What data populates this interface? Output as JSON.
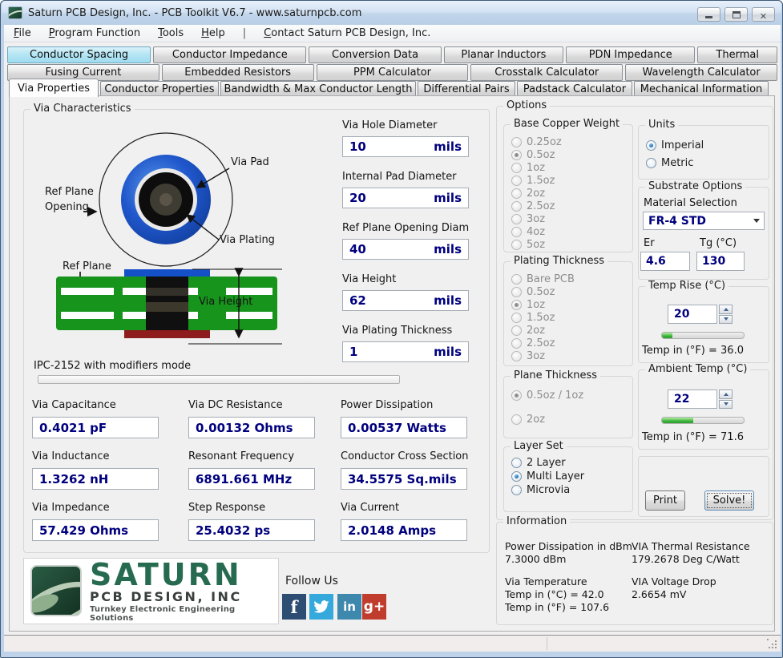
{
  "titlebar": {
    "title": "Saturn PCB Design, Inc. - PCB Toolkit V6.7 - www.saturnpcb.com"
  },
  "menubar": {
    "items": [
      "File",
      "Program Function",
      "Tools",
      "Help"
    ],
    "separator": "|",
    "contact": "Contact Saturn PCB Design, Inc."
  },
  "tabs": {
    "row1": [
      "Conductor Spacing",
      "Conductor Impedance",
      "Conversion Data",
      "Planar Inductors",
      "PDN Impedance",
      "Thermal"
    ],
    "row2": [
      "Fusing Current",
      "Embedded Resistors",
      "PPM Calculator",
      "Crosstalk Calculator",
      "Wavelength Calculator"
    ],
    "row3": [
      "Via Properties",
      "Conductor Properties",
      "Bandwidth & Max Conductor Length",
      "Differential Pairs",
      "Padstack Calculator",
      "Mechanical Information"
    ],
    "active_row1": "Conductor Spacing",
    "active_row3": "Via Properties"
  },
  "via": {
    "title": "Via Characteristics",
    "diagram": {
      "via_pad": "Via Pad",
      "ref_plane": "Ref Plane",
      "opening": "Opening",
      "via_plating": "Via Plating",
      "ref_plane2": "Ref Plane",
      "via_height": "Via Height"
    },
    "mode_note": "IPC-2152 with modifiers mode",
    "inputs": [
      {
        "label": "Via Hole Diameter",
        "value": "10",
        "unit": "mils"
      },
      {
        "label": "Internal Pad Diameter",
        "value": "20",
        "unit": "mils"
      },
      {
        "label": "Ref Plane Opening Diam",
        "value": "40",
        "unit": "mils"
      },
      {
        "label": "Via Height",
        "value": "62",
        "unit": "mils"
      },
      {
        "label": "Via Plating Thickness",
        "value": "1",
        "unit": "mils"
      }
    ],
    "results": [
      {
        "label": "Via Capacitance",
        "value": "0.4021 pF"
      },
      {
        "label": "Via DC Resistance",
        "value": "0.00132 Ohms"
      },
      {
        "label": "Power Dissipation",
        "value": "0.00537 Watts"
      },
      {
        "label": "Via Inductance",
        "value": "1.3262 nH"
      },
      {
        "label": "Resonant Frequency",
        "value": "6891.661 MHz"
      },
      {
        "label": "Conductor Cross Section",
        "value": "34.5575 Sq.mils"
      },
      {
        "label": "Via Impedance",
        "value": "57.429 Ohms"
      },
      {
        "label": "Step Response",
        "value": "25.4032 ps"
      },
      {
        "label": "Via Current",
        "value": "2.0148 Amps"
      }
    ]
  },
  "options": {
    "title": "Options",
    "base_copper_weight": {
      "title": "Base Copper Weight",
      "options": [
        "0.25oz",
        "0.5oz",
        "1oz",
        "1.5oz",
        "2oz",
        "2.5oz",
        "3oz",
        "4oz",
        "5oz"
      ],
      "selected": "0.5oz"
    },
    "plating_thickness": {
      "title": "Plating Thickness",
      "options": [
        "Bare PCB",
        "0.5oz",
        "1oz",
        "1.5oz",
        "2oz",
        "2.5oz",
        "3oz"
      ],
      "selected": "1oz"
    },
    "plane_thickness": {
      "title": "Plane Thickness",
      "options": [
        "0.5oz / 1oz",
        "2oz"
      ],
      "selected": "0.5oz / 1oz"
    },
    "layer_set": {
      "title": "Layer Set",
      "options": [
        "2 Layer",
        "Multi Layer",
        "Microvia"
      ],
      "selected": "Multi Layer"
    },
    "units": {
      "title": "Units",
      "options": [
        "Imperial",
        "Metric"
      ],
      "selected": "Imperial"
    },
    "substrate": {
      "title": "Substrate Options",
      "material_label": "Material Selection",
      "material_value": "FR-4 STD",
      "er_label": "Er",
      "er_value": "4.6",
      "tg_label": "Tg (°C)",
      "tg_value": "130"
    },
    "temp_rise": {
      "title": "Temp Rise (°C)",
      "value": "20",
      "converted": "Temp in (°F) = 36.0",
      "slider_percent": 13
    },
    "ambient_temp": {
      "title": "Ambient Temp (°C)",
      "value": "22",
      "converted": "Temp in (°F) = 71.6",
      "slider_percent": 38
    },
    "print_label": "Print",
    "solve_label": "Solve!"
  },
  "information": {
    "title": "Information",
    "power_dbm_label": "Power Dissipation in dBm",
    "power_dbm_value": "7.3000 dBm",
    "thermal_label": "VIA Thermal Resistance",
    "thermal_value": "179.2678 Deg C/Watt",
    "via_temp_label": "Via Temperature",
    "via_temp_c": "Temp in (°C) = 42.0",
    "via_temp_f": "Temp in (°F) = 107.6",
    "voltage_label": "VIA Voltage Drop",
    "voltage_value": "2.6654 mV"
  },
  "footer": {
    "logo_line1": "SATURN",
    "logo_line2": "PCB DESIGN, INC",
    "logo_tagline": "Turnkey Electronic Engineering Solutions",
    "follow_us": "Follow Us",
    "social": [
      "facebook",
      "twitter",
      "linkedin",
      "google-plus"
    ]
  },
  "colors": {
    "value_navy": "#00007e",
    "pcb_green": "#17941c",
    "via_pad_blue": "#1d52c8",
    "active_tab_cyan": "#b7e6f4",
    "logo_green": "#266a50",
    "facebook": "#2e4d73",
    "twitter": "#35a8dc",
    "linkedin": "#3e87ad",
    "google_plus": "#c03c2c"
  }
}
